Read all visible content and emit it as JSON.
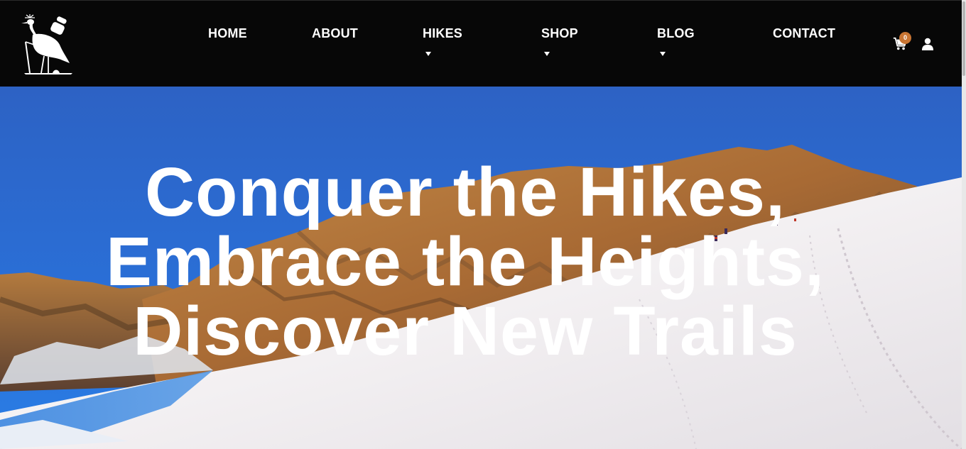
{
  "nav": {
    "items": [
      {
        "label": "HOME",
        "has_dropdown": false
      },
      {
        "label": "ABOUT",
        "has_dropdown": false
      },
      {
        "label": "HIKES",
        "has_dropdown": true
      },
      {
        "label": "SHOP",
        "has_dropdown": true
      },
      {
        "label": "BLOG",
        "has_dropdown": true
      },
      {
        "label": "CONTACT",
        "has_dropdown": false
      }
    ],
    "cart_count": "0"
  },
  "hero": {
    "title": "Conquer the Hikes, Embrace the Heights, Discover New Trails"
  },
  "icons": {
    "logo": "crane-hiker-logo",
    "cart": "cart-icon",
    "account": "user-icon",
    "dropdown": "caret-down-icon"
  },
  "colors": {
    "header_bg": "#070707",
    "nav_text": "#ffffff",
    "cart_badge": "#c87533",
    "sky": "#2a6fd6",
    "snow": "#f1eef0"
  }
}
